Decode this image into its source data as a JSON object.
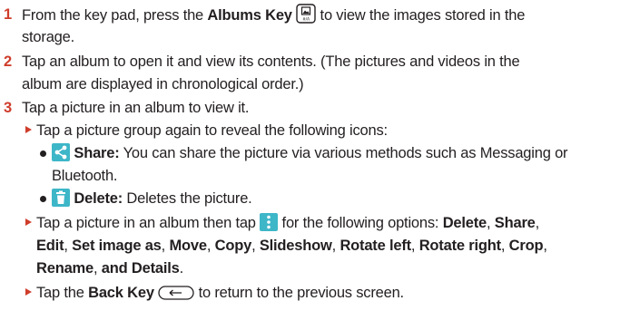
{
  "steps": [
    {
      "number": "1",
      "pre": "From the key pad, press the ",
      "key": "Albums Key",
      "post": " to view the images stored in the",
      "cont": "storage.",
      "icon": "albums-key-icon"
    },
    {
      "number": "2",
      "line1": "Tap an album to open it and view its contents. (The pictures and videos in the",
      "line2": "album are displayed in chronological order.)"
    },
    {
      "number": "3",
      "line1": "Tap a picture in an album to view it."
    }
  ],
  "bullets": {
    "reveal": "Tap a picture group again to reveal the following icons:",
    "share": {
      "label": "Share:",
      "text": " You can share the picture via various methods such as Messaging or",
      "cont": "Bluetooth.",
      "icon": "share-icon"
    },
    "delete": {
      "label": "Delete:",
      "text": " Deletes the picture.",
      "icon": "trash-icon"
    },
    "options": {
      "pre": "Tap a picture in an album then tap ",
      "post": " for the following options: ",
      "icon": "menu-dots-icon",
      "items": [
        "Delete",
        "Share",
        "Edit",
        "Set image as",
        "Move",
        "Copy",
        "Slideshow",
        "Rotate left",
        "Rotate right",
        "Crop",
        "Rename"
      ],
      "sep": ", ",
      "and_details": "and Details",
      "end": "."
    },
    "back": {
      "pre": "Tap the ",
      "key": "Back Key",
      "post": " to return to the previous screen.",
      "icon": "back-key-icon"
    }
  },
  "colors": {
    "accent": "#cf3d2b",
    "icon_teal": "#3db6c8",
    "text": "#231f20"
  }
}
